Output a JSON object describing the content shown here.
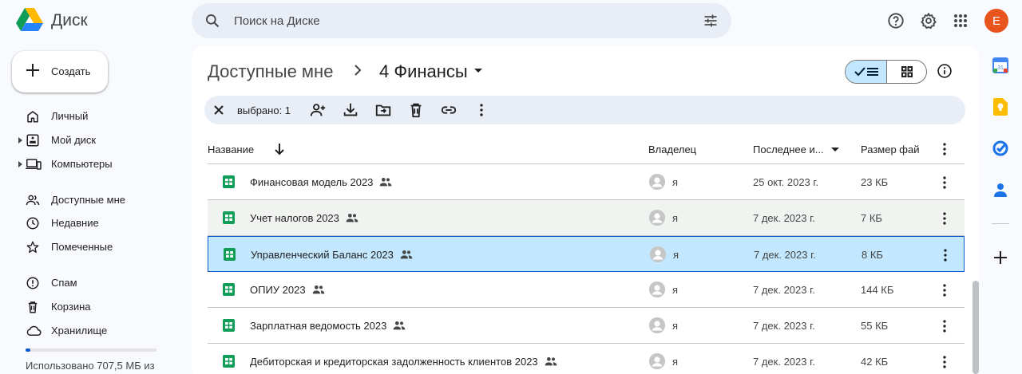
{
  "app": {
    "name": "Диск"
  },
  "search": {
    "placeholder": "Поиск на Диске"
  },
  "header": {
    "avatar_letter": "E"
  },
  "sidebar": {
    "create_label": "Создать",
    "items": [
      {
        "label": "Личный",
        "icon": "home-icon",
        "caret": false
      },
      {
        "label": "Мой диск",
        "icon": "my-drive-icon",
        "caret": true
      },
      {
        "label": "Компьютеры",
        "icon": "computers-icon",
        "caret": true
      },
      {
        "label": "Доступные мне",
        "icon": "shared-icon",
        "caret": false
      },
      {
        "label": "Недавние",
        "icon": "clock-icon",
        "caret": false
      },
      {
        "label": "Помеченные",
        "icon": "star-icon",
        "caret": false
      },
      {
        "label": "Спам",
        "icon": "spam-icon",
        "caret": false
      },
      {
        "label": "Корзина",
        "icon": "trash-icon",
        "caret": false
      },
      {
        "label": "Хранилище",
        "icon": "cloud-icon",
        "caret": false
      }
    ],
    "storage_text": "Использовано 707,5 МБ из",
    "storage_fraction": 0.035
  },
  "breadcrumb": {
    "parent": "Доступные мне",
    "current": "4 Финансы"
  },
  "selection": {
    "label": "выбрано: 1"
  },
  "table": {
    "columns": {
      "name": "Название",
      "owner": "Владелец",
      "modified": "Последнее и...",
      "size": "Размер фай"
    },
    "rows": [
      {
        "name": "Финансовая модель 2023",
        "owner": "я",
        "date": "25 окт. 2023 г.",
        "size": "23 КБ",
        "state": "normal"
      },
      {
        "name": "Учет налогов 2023",
        "owner": "я",
        "date": "7 дек. 2023 г.",
        "size": "7 КБ",
        "state": "hover"
      },
      {
        "name": "Управленческий Баланс 2023",
        "owner": "я",
        "date": "7 дек. 2023 г.",
        "size": "8 КБ",
        "state": "selected"
      },
      {
        "name": "ОПИУ 2023",
        "owner": "я",
        "date": "7 дек. 2023 г.",
        "size": "144 КБ",
        "state": "normal"
      },
      {
        "name": "Зарплатная ведомость 2023",
        "owner": "я",
        "date": "7 дек. 2023 г.",
        "size": "55 КБ",
        "state": "normal"
      },
      {
        "name": "Дебиторская и кредиторская задолженность клиентов 2023",
        "owner": "я",
        "date": "7 дек. 2023 г.",
        "size": "42 КБ",
        "state": "normal"
      }
    ]
  },
  "colors": {
    "accent": "#0b57d0",
    "selected_bg": "#c2e7ff",
    "sheets_green": "#0f9d58",
    "avatar": "#e8541d"
  }
}
